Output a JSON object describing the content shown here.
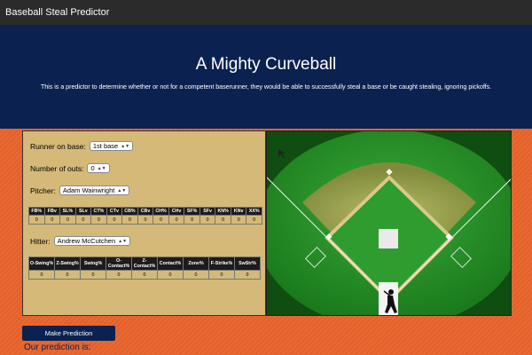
{
  "app": {
    "title": "Baseball Steal Predictor"
  },
  "hero": {
    "title": "A Mighty Curveball",
    "description": "This is a predictor to determine whether or not for a competent baserunner, they would be able to successfully steal a base or be caught stealing, ignoring pickoffs."
  },
  "form": {
    "runner_label": "Runner on base:",
    "runner_value": "1st base",
    "outs_label": "Number of outs:",
    "outs_value": "0",
    "pitcher_label": "Pitcher:",
    "pitcher_value": "Adam Wainwright",
    "hitter_label": "Hitter:",
    "hitter_value": "Andrew McCutchen"
  },
  "pitcher_table": {
    "headers": [
      "FB%",
      "FBv",
      "SL%",
      "SLv",
      "CT%",
      "CTv",
      "CB%",
      "CBv",
      "CH%",
      "CHv",
      "SF%",
      "SFv",
      "KN%",
      "KNv",
      "XX%"
    ],
    "values": [
      "0",
      "0",
      "0",
      "0",
      "0",
      "0",
      "0",
      "0",
      "0",
      "0",
      "0",
      "0",
      "0",
      "0",
      "0"
    ]
  },
  "hitter_table": {
    "headers": [
      "O-Swing%",
      "Z-Swing%",
      "Swing%",
      "O-Contact%",
      "Z-Contact%",
      "Contact%",
      "Zone%",
      "F-Strike%",
      "SwStr%"
    ],
    "values": [
      "0",
      "0",
      "0",
      "0",
      "0",
      "0",
      "0",
      "0",
      "0"
    ]
  },
  "actions": {
    "predict_label": "Make Prediction"
  },
  "result": {
    "label": "Our prediction is:"
  },
  "colors": {
    "navy": "#0b2250",
    "tan": "#d4b978",
    "orange": "#e8652f",
    "grass": "#1d8a1f"
  }
}
